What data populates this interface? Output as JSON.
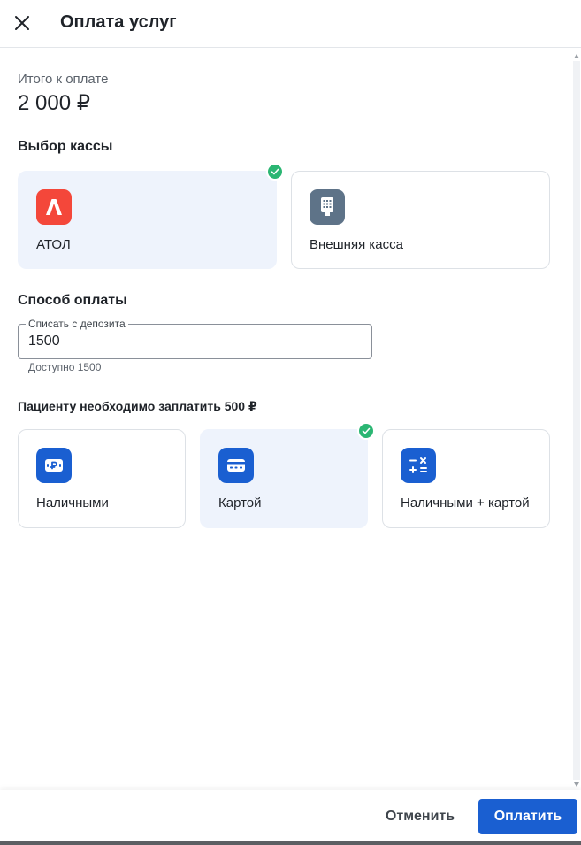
{
  "header": {
    "title": "Оплата услуг",
    "close_icon": "close-icon"
  },
  "total": {
    "label": "Итого к оплате",
    "value": "2 000 ₽"
  },
  "cash_register": {
    "title": "Выбор кассы",
    "options": [
      {
        "label": "АТОЛ",
        "icon": "atol-logo-icon",
        "icon_color": "#f4473a",
        "selected": true
      },
      {
        "label": "Внешняя касса",
        "icon": "cash-register-icon",
        "icon_color": "#5e7388",
        "selected": false
      }
    ]
  },
  "payment": {
    "title": "Способ оплаты",
    "deposit_field": {
      "label": "Списать с депозита",
      "value": "1500",
      "helper": "Доступно 1500"
    },
    "patient_note": "Пациенту необходимо заплатить 500 ₽",
    "methods": [
      {
        "label": "Наличными",
        "icon": "cash-icon",
        "icon_color": "#1a5fd1",
        "selected": false
      },
      {
        "label": "Картой",
        "icon": "card-icon",
        "icon_color": "#1a5fd1",
        "selected": true
      },
      {
        "label": "Наличными + картой",
        "icon": "calculator-icon",
        "icon_color": "#1a5fd1",
        "selected": false
      }
    ]
  },
  "footer": {
    "cancel_label": "Отменить",
    "pay_label": "Оплатить"
  },
  "colors": {
    "accent": "#1a5fd1",
    "selected_bg": "#eef3fc",
    "check": "#2bb673"
  }
}
